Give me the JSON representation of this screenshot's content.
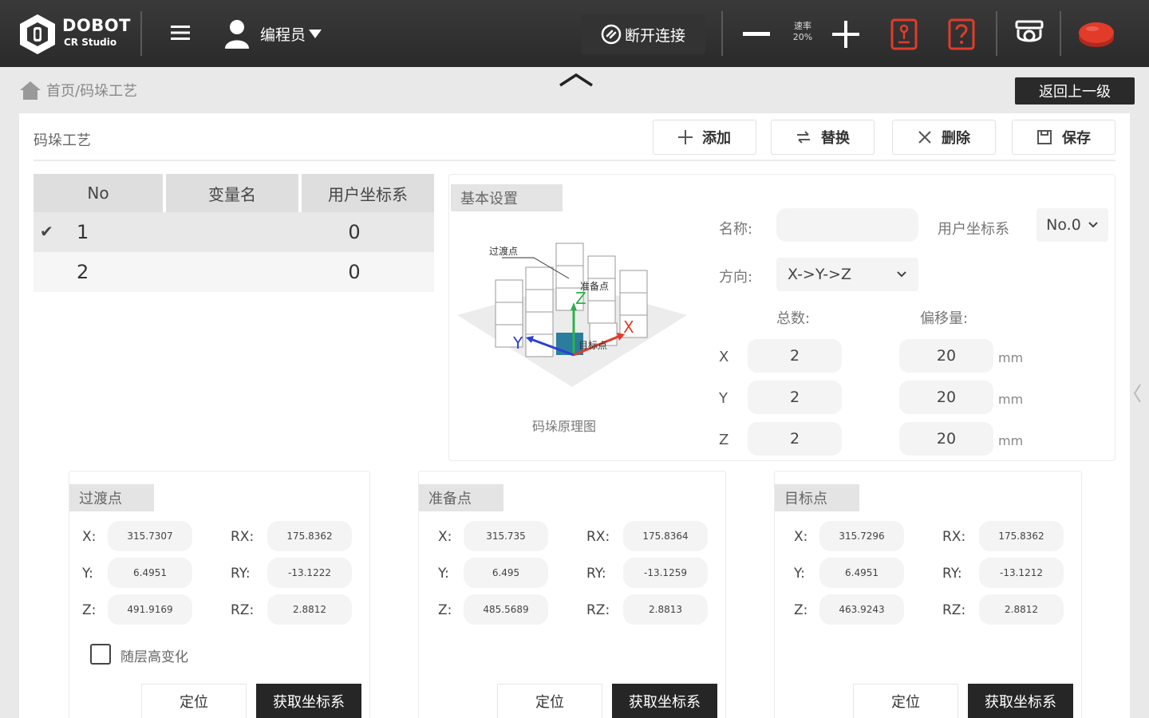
{
  "header": {
    "logo_text": "DOBOT",
    "logo_sub": "CR Studio",
    "user_label": "编程员",
    "connect_label": "断开连接",
    "speed_label": "速率",
    "speed_value": "20%"
  },
  "breadcrumb": "首页/码垛工艺",
  "back_label": "返回上一级",
  "panel": {
    "title": "码垛工艺",
    "buttons": {
      "add": "添加",
      "replace": "替换",
      "delete": "删除",
      "save": "保存"
    }
  },
  "table": {
    "headers": [
      "No",
      "变量名",
      "用户坐标系"
    ],
    "rows": [
      {
        "no": "1",
        "name": "",
        "coord": "0",
        "selected": true
      },
      {
        "no": "2",
        "name": "",
        "coord": "0",
        "selected": false
      }
    ]
  },
  "settings": {
    "tab": "基本设置",
    "diagram": {
      "caption": "码垛原理图",
      "transition_label": "过渡点",
      "prepare_label": "准备点",
      "target_label": "目标点",
      "axis_x": "X",
      "axis_y": "Y",
      "axis_z": "Z"
    },
    "name_label": "名称:",
    "name_value": "",
    "coord_label": "用户坐标系",
    "coord_value": "No.0",
    "direction_label": "方向:",
    "direction_value": "X->Y->Z",
    "total_label": "总数:",
    "offset_label": "偏移量:",
    "axes": [
      {
        "axis": "X",
        "total": "2",
        "offset": "20",
        "unit": "mm"
      },
      {
        "axis": "Y",
        "total": "2",
        "offset": "20",
        "unit": "mm"
      },
      {
        "axis": "Z",
        "total": "2",
        "offset": "20",
        "unit": "mm"
      }
    ]
  },
  "points": [
    {
      "title": "过渡点",
      "x": "315.7307",
      "y": "6.4951",
      "z": "491.9169",
      "rx": "175.8362",
      "ry": "-13.1222",
      "rz": "2.8812",
      "checkbox_label": "随层高变化",
      "locate": "定位",
      "get": "获取坐标系"
    },
    {
      "title": "准备点",
      "x": "315.735",
      "y": "6.495",
      "z": "485.5689",
      "rx": "175.8364",
      "ry": "-13.1259",
      "rz": "2.8813",
      "locate": "定位",
      "get": "获取坐标系"
    },
    {
      "title": "目标点",
      "x": "315.7296",
      "y": "6.4951",
      "z": "463.9243",
      "rx": "175.8362",
      "ry": "-13.1212",
      "rz": "2.8812",
      "locate": "定位",
      "get": "获取坐标系"
    }
  ],
  "labels": {
    "x": "X:",
    "y": "Y:",
    "z": "Z:",
    "rx": "RX:",
    "ry": "RY:",
    "rz": "RZ:"
  },
  "colors": {
    "accent_red": "#e23b2a",
    "topbar": "#303030",
    "dark_button": "#262626"
  }
}
